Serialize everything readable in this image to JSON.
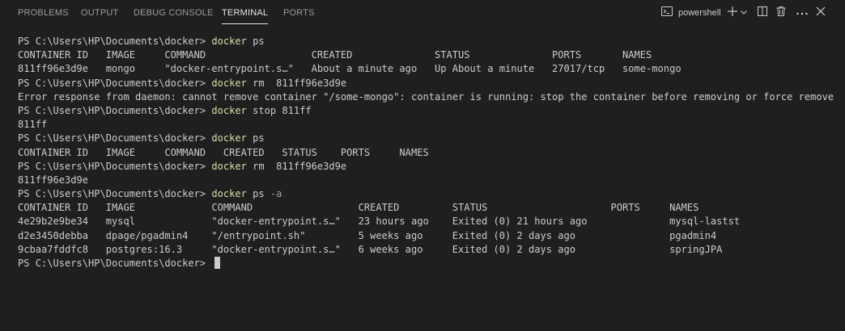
{
  "tabs": [
    {
      "label": "PROBLEMS"
    },
    {
      "label": "OUTPUT"
    },
    {
      "label": "DEBUG CONSOLE"
    },
    {
      "label": "TERMINAL"
    },
    {
      "label": "PORTS"
    }
  ],
  "shell": {
    "label": "powershell"
  },
  "terminal": {
    "prompt": "PS C:\\Users\\HP\\Documents\\docker> ",
    "lines": [
      {
        "type": "cmd",
        "cmd": "docker",
        "args": " ps",
        "flag": ""
      },
      {
        "type": "out",
        "text": "CONTAINER ID   IMAGE     COMMAND                  CREATED              STATUS              PORTS       NAMES"
      },
      {
        "type": "out",
        "text": "811ff96e3d9e   mongo     \"docker-entrypoint.s…\"   About a minute ago   Up About a minute   27017/tcp   some-mongo"
      },
      {
        "type": "cmd",
        "cmd": "docker",
        "args": " rm  811ff96e3d9e",
        "flag": ""
      },
      {
        "type": "out",
        "text": "Error response from daemon: cannot remove container \"/some-mongo\": container is running: stop the container before removing or force remove"
      },
      {
        "type": "cmd",
        "cmd": "docker",
        "args": " stop 811ff",
        "flag": ""
      },
      {
        "type": "out",
        "text": "811ff"
      },
      {
        "type": "cmd",
        "cmd": "docker",
        "args": " ps",
        "flag": ""
      },
      {
        "type": "out",
        "text": "CONTAINER ID   IMAGE     COMMAND   CREATED   STATUS    PORTS     NAMES"
      },
      {
        "type": "cmd",
        "cmd": "docker",
        "args": " rm  811ff96e3d9e",
        "flag": ""
      },
      {
        "type": "out",
        "text": "811ff96e3d9e"
      },
      {
        "type": "cmd",
        "cmd": "docker",
        "args": " ps ",
        "flag": "-a"
      },
      {
        "type": "out",
        "text": "CONTAINER ID   IMAGE             COMMAND                  CREATED         STATUS                     PORTS     NAMES"
      },
      {
        "type": "out",
        "text": "4e29b2e9be34   mysql             \"docker-entrypoint.s…\"   23 hours ago    Exited (0) 21 hours ago              mysql-lastst"
      },
      {
        "type": "out",
        "text": "d2e3450debba   dpage/pgadmin4    \"/entrypoint.sh\"         5 weeks ago     Exited (0) 2 days ago                pgadmin4"
      },
      {
        "type": "out",
        "text": "9cbaa7fddfc8   postgres:16.3     \"docker-entrypoint.s…\"   6 weeks ago     Exited (0) 2 days ago                springJPA"
      },
      {
        "type": "prompt"
      }
    ]
  },
  "colors": {
    "background": "#1f1f1f",
    "text": "#cccccc",
    "command": "#dcdcaa",
    "flag": "#9d9d9d"
  }
}
